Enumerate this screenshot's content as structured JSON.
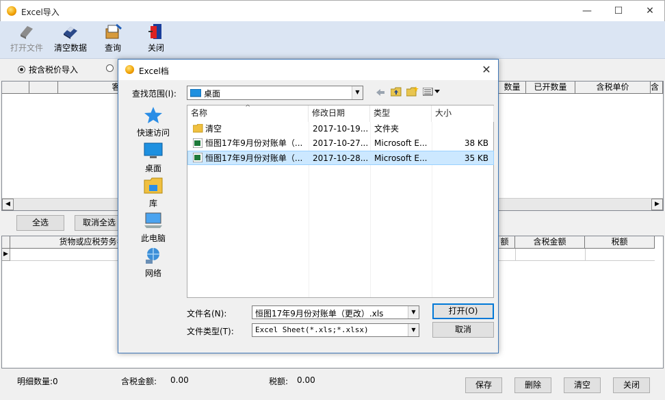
{
  "app": {
    "title": "Excel导入",
    "minimize": "—",
    "maximize": "☐",
    "close": "✕"
  },
  "toolbar": [
    {
      "label": "打开文件",
      "disabled": true
    },
    {
      "label": "清空数据",
      "disabled": false
    },
    {
      "label": "查询",
      "disabled": false
    },
    {
      "label": "关闭",
      "disabled": false
    }
  ],
  "radio": {
    "option1": "按含税价导入",
    "option1_selected": true
  },
  "grid1": {
    "headers_left": [
      "",
      "",
      "客"
    ],
    "headers_right": [
      "数量",
      "已开数量",
      "含税单价",
      "含"
    ]
  },
  "mid_buttons": {
    "select_all": "全选",
    "deselect_all": "取消全选"
  },
  "grid2": {
    "headers_left": [
      "",
      "货物或应税劳务名"
    ],
    "headers_right": [
      "额",
      "含税金额",
      "税额"
    ]
  },
  "status": {
    "count_label": "明细数量:0",
    "amount_label": "含税金额:",
    "amount_value": "0.00",
    "tax_label": "税额:",
    "tax_value": "0.00"
  },
  "bottom_buttons": {
    "save": "保存",
    "delete": "删除",
    "clear": "清空",
    "close": "关闭"
  },
  "dialog": {
    "title": "Excel档",
    "close": "✕",
    "lookin_label": "查找范围(I):",
    "lookin_value": "桌面",
    "places": [
      "快速访问",
      "桌面",
      "库",
      "此电脑",
      "网络"
    ],
    "columns": [
      "名称",
      "修改日期",
      "类型",
      "大小"
    ],
    "files": [
      {
        "name": "清空",
        "date": "2017-10-19...",
        "type": "文件夹",
        "size": "",
        "kind": "folder",
        "selected": false
      },
      {
        "name": "恒图17年9月份对账单（...",
        "date": "2017-10-27...",
        "type": "Microsoft E...",
        "size": "38 KB",
        "kind": "excel",
        "selected": false
      },
      {
        "name": "恒图17年9月份对账单（...",
        "date": "2017-10-28...",
        "type": "Microsoft E...",
        "size": "35 KB",
        "kind": "excel",
        "selected": true
      }
    ],
    "filename_label": "文件名(N):",
    "filename_value": "恒图17年9月份对账单（更改）.xls",
    "filetype_label": "文件类型(T):",
    "filetype_value": "Excel Sheet(*.xls;*.xlsx)",
    "open_button": "打开(O)",
    "cancel_button": "取消"
  }
}
